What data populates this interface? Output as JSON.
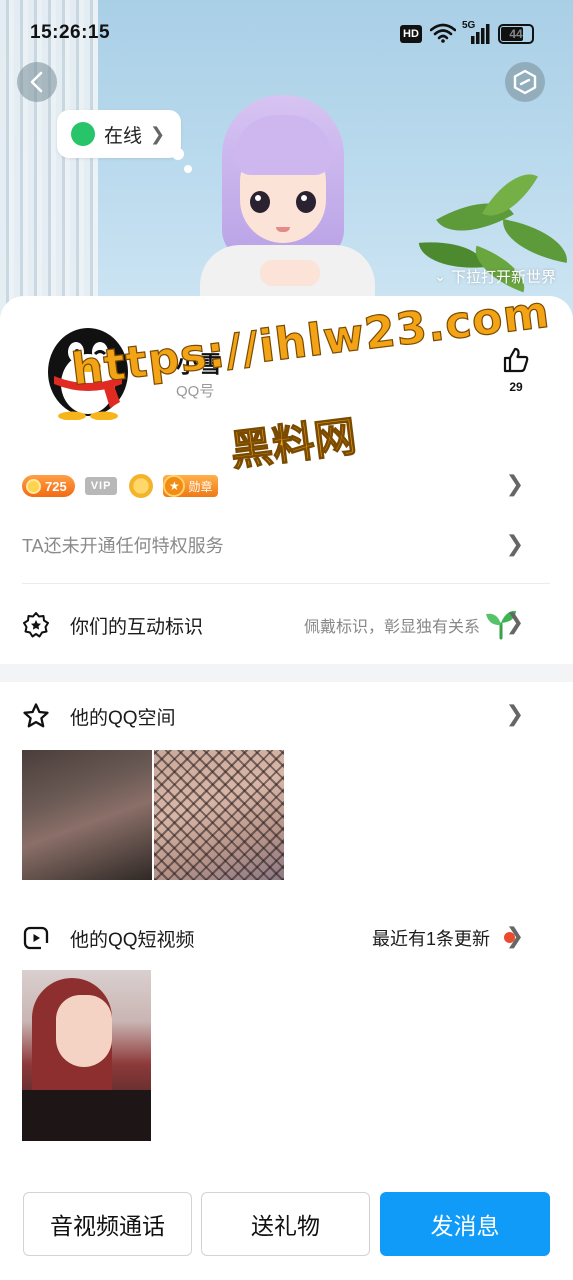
{
  "status_bar": {
    "time": "15:26:15",
    "hd": "HD",
    "network": "5G",
    "battery": "44"
  },
  "header": {
    "online_status": "在线",
    "pull_hint": "下拉打开新世界"
  },
  "profile": {
    "nickname": "小雪",
    "qq_number_label": "QQ号",
    "like_count": "29"
  },
  "watermark": {
    "url": "https://ihlw23.com",
    "name": "黑料网"
  },
  "badges": {
    "coin_value": "725",
    "vip_label": "VIP",
    "medal_label": "勋章"
  },
  "privilege": {
    "text": "TA还未开通任何特权服务"
  },
  "interaction": {
    "title": "你们的互动标识",
    "hint": "佩戴标识，彰显独有关系"
  },
  "qzone": {
    "title": "他的QQ空间"
  },
  "short_video": {
    "title": "他的QQ短视频",
    "update_text": "最近有1条更新"
  },
  "actions": {
    "call": "音视频通话",
    "gift": "送礼物",
    "message": "发消息"
  },
  "colors": {
    "primary": "#0f9bf7",
    "online": "#28c46a",
    "coin": "#f26a14",
    "notice_dot": "#ea4b2e"
  }
}
